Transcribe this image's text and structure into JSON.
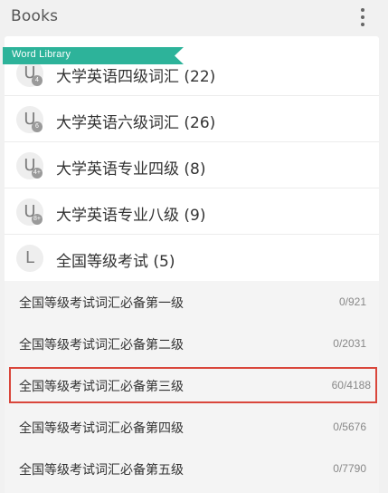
{
  "header": {
    "title": "Books",
    "menu_icon": "more-vert-icon"
  },
  "ribbon": {
    "label": "Word Library",
    "color": "#2db39a"
  },
  "libraries": [
    {
      "letter": "U",
      "badge": "4",
      "label": "大学英语四级词汇 (22)"
    },
    {
      "letter": "U",
      "badge": "6",
      "label": "大学英语六级词汇 (26)"
    },
    {
      "letter": "U",
      "badge": "4+",
      "label": "大学英语专业四级 (8)"
    },
    {
      "letter": "U",
      "badge": "8+",
      "label": "大学英语专业八级 (9)"
    },
    {
      "letter": "L",
      "badge": "",
      "label": "全国等级考试 (5)"
    }
  ],
  "books": [
    {
      "label": "全国等级考试词汇必备第一级",
      "count": "0/921"
    },
    {
      "label": "全国等级考试词汇必备第二级",
      "count": "0/2031"
    },
    {
      "label": "全国等级考试词汇必备第三级",
      "count": "60/4188",
      "selected": true
    },
    {
      "label": "全国等级考试词汇必备第四级",
      "count": "0/5676"
    },
    {
      "label": "全国等级考试词汇必备第五级",
      "count": "0/7790"
    }
  ],
  "colors": {
    "highlight": "#d9463b",
    "ribbon": "#2db39a"
  }
}
